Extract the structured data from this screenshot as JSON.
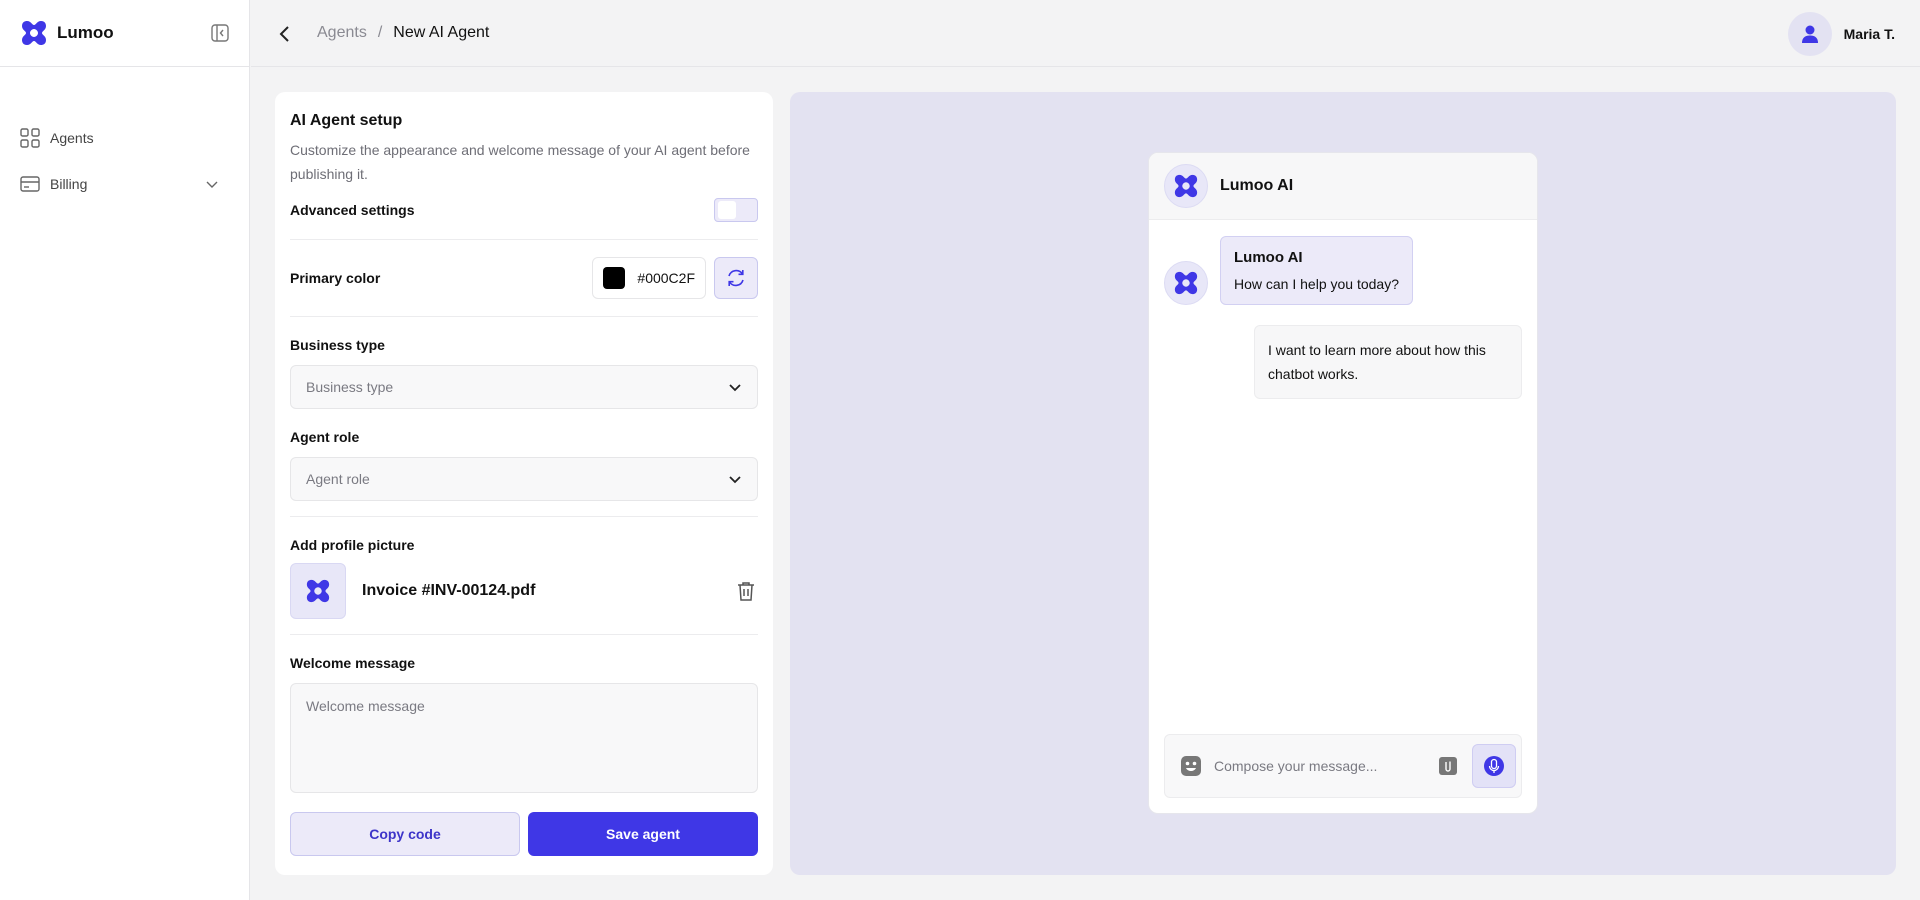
{
  "app": {
    "brand": "Lumoo"
  },
  "sidebar": {
    "items": [
      {
        "label": "Agents",
        "icon": "grid-icon"
      },
      {
        "label": "Billing",
        "icon": "card-icon",
        "expandable": true
      }
    ]
  },
  "header": {
    "breadcrumb_parent": "Agents",
    "breadcrumb_separator": "/",
    "breadcrumb_current": "New AI Agent",
    "user_name": "Maria T."
  },
  "setup": {
    "title": "AI Agent setup",
    "description": "Customize the appearance and welcome message of your AI agent before publishing it.",
    "advanced_label": "Advanced settings",
    "advanced_enabled": false,
    "primary_color_label": "Primary color",
    "primary_color_value": "#000C2F",
    "business_type_label": "Business type",
    "business_type_placeholder": "Business type",
    "agent_role_label": "Agent role",
    "agent_role_placeholder": "Agent role",
    "profile_picture_label": "Add profile picture",
    "profile_picture_file": "Invoice #INV-00124.pdf",
    "welcome_label": "Welcome message",
    "welcome_placeholder": "Welcome message",
    "copy_button": "Copy code",
    "save_button": "Save agent"
  },
  "preview": {
    "chat_title": "Lumoo AI",
    "bot_sender": "Lumoo AI",
    "bot_message": "How can I help you today?",
    "user_message": "I want to learn more about how this chatbot works.",
    "composer_placeholder": "Compose your message..."
  },
  "colors": {
    "accent": "#3F37E6",
    "accent_light": "#ECEAF9",
    "preview_bg": "#E3E2F1"
  }
}
